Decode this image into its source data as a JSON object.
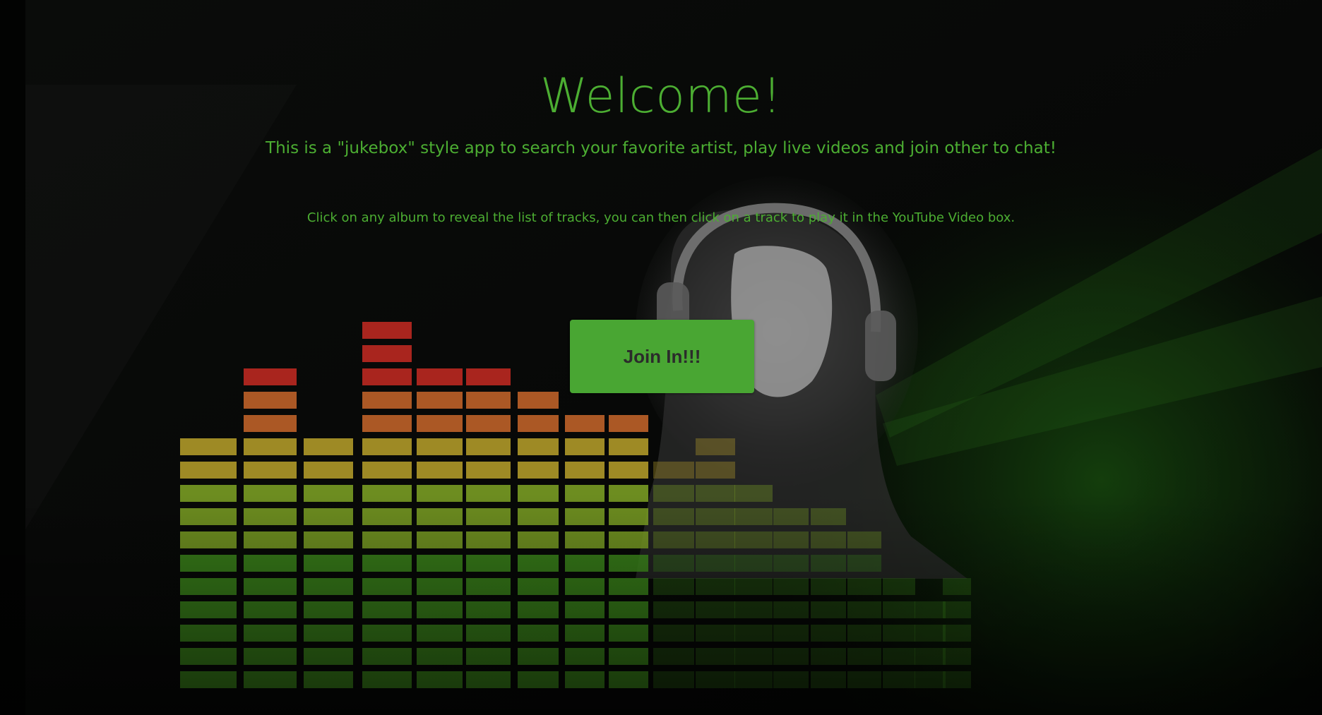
{
  "hero": {
    "title": "Welcome!",
    "subtitle": "This is a \"jukebox\" style app to search your favorite artist, play live videos and join other to chat!",
    "hint": "Click on any album to reveal the list of tracks, you can then click on a track to play it in the YouTube Video box.",
    "join_label": "Join In!!!"
  },
  "theme": {
    "accent": "#4cae32",
    "button_bg": "#49a633",
    "button_text": "#2b2b2b",
    "background": "#020302"
  },
  "background_image": {
    "icon": "equalizer-headphones-illustration"
  }
}
